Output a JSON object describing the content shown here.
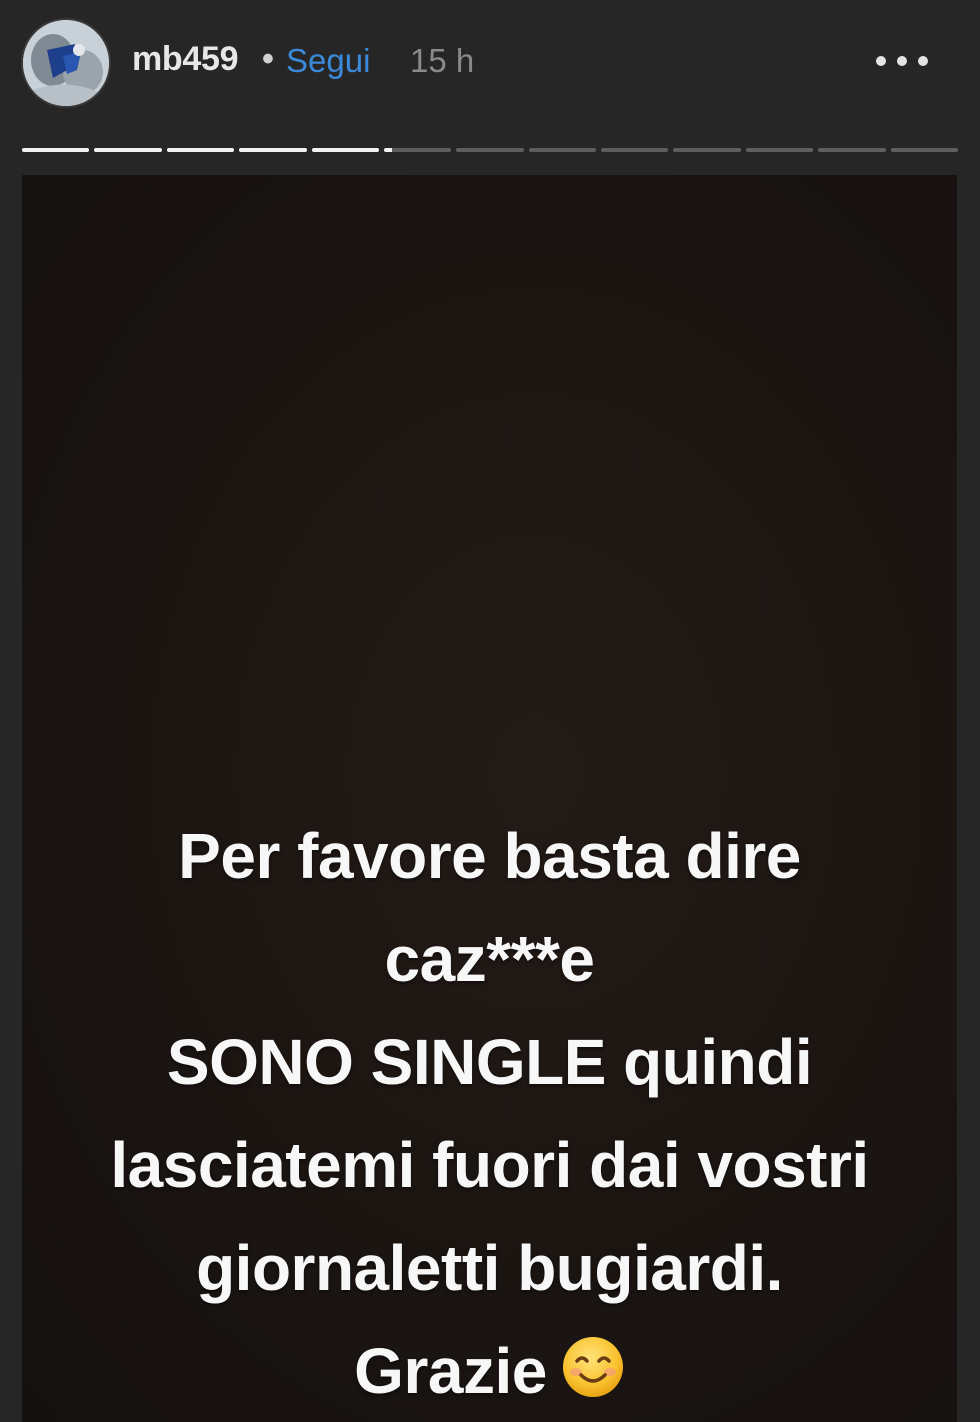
{
  "header": {
    "username": "mb459",
    "separator": "•",
    "follow_label": "Segui",
    "timestamp": "15 h",
    "more_icon": "more-horizontal-icon"
  },
  "progress": {
    "segment_count": 13,
    "completed_segments": 5,
    "current_segment_progress": 0.12
  },
  "story": {
    "caption_lines": [
      "Per favore basta dire",
      "caz***e",
      "SONO SINGLE quindi",
      "lasciatemi fuori dai vostri",
      "giornaletti bugiardi.",
      "Grazie"
    ],
    "caption_emoji": "smiling-face-emoji"
  },
  "colors": {
    "background": "#262626",
    "follow_link": "#3b89d9",
    "timestamp": "#8a8a8a",
    "caption_text": "#f7f7f7",
    "progress_done": "#f2f2f2",
    "progress_todo": "#5e5e5e"
  }
}
